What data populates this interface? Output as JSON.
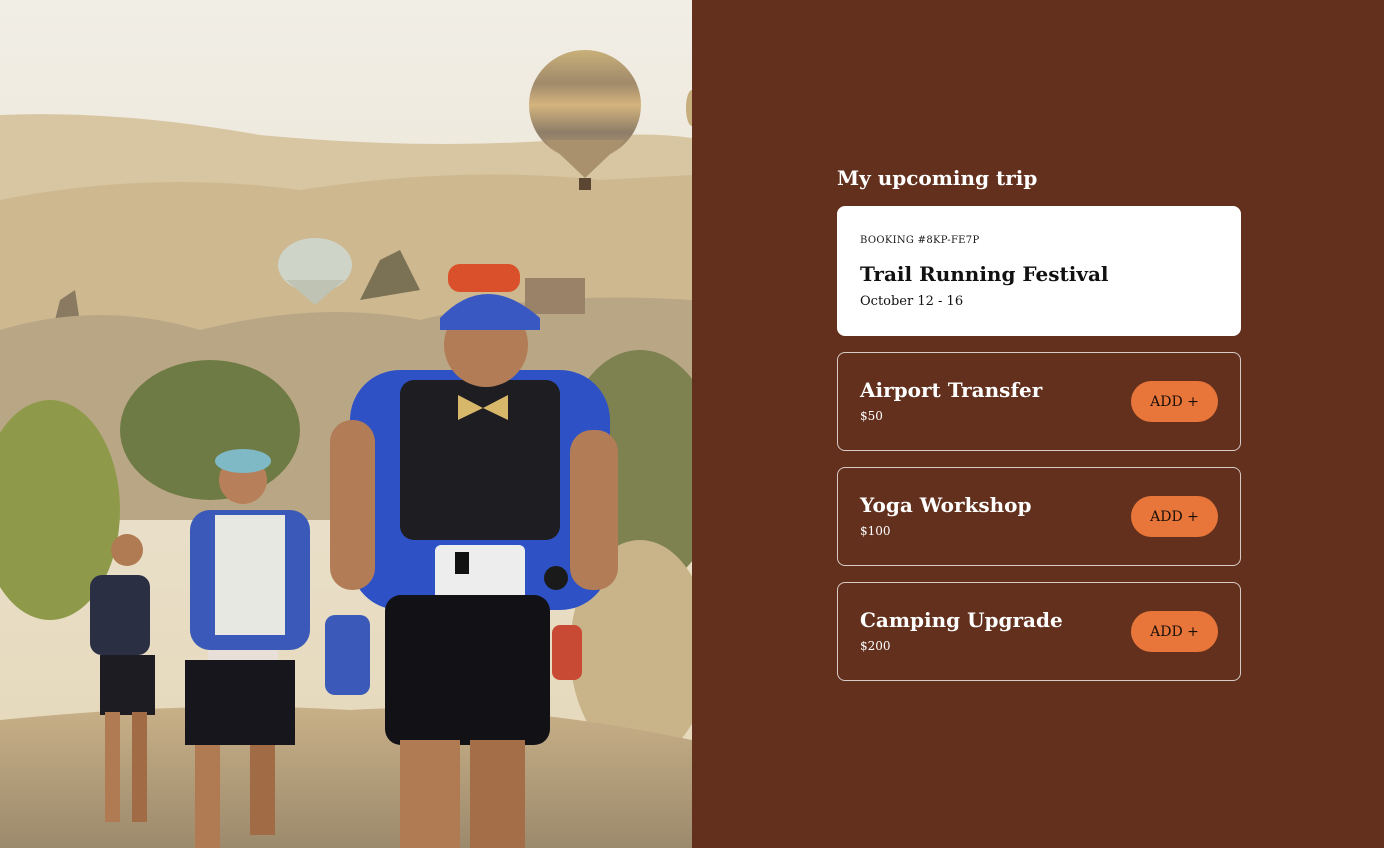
{
  "hero_image": {
    "icon": "trail-runners-photo"
  },
  "trip": {
    "heading": "My upcoming trip",
    "booking": {
      "id": "BOOKING #8KP-FE7P",
      "event": "Trail Running Festival",
      "dates": "October 12 - 16"
    }
  },
  "addons": [
    {
      "name": "Airport Transfer",
      "price": "$50",
      "button": "ADD +"
    },
    {
      "name": "Yoga Workshop",
      "price": "$100",
      "button": "ADD +"
    },
    {
      "name": "Camping Upgrade",
      "price": "$200",
      "button": "ADD +"
    }
  ],
  "colors": {
    "background": "#62301d",
    "accent": "#e8763a",
    "card": "#ffffff"
  }
}
